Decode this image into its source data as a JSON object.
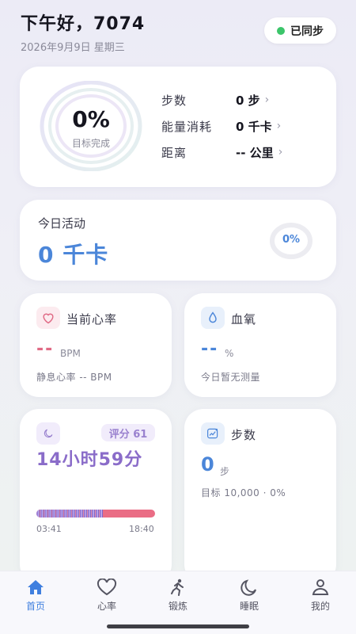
{
  "header": {
    "greeting": "下午好，7074",
    "date": "2026年9月9日 星期三",
    "sync_label": "已同步"
  },
  "goal_card": {
    "percent": "0%",
    "label": "目标完成",
    "metrics": [
      {
        "label": "步数",
        "value": "0 步"
      },
      {
        "label": "能量消耗",
        "value": "0 千卡"
      },
      {
        "label": "距离",
        "value": "-- 公里"
      }
    ]
  },
  "activity": {
    "title": "今日活动",
    "value": "0 千卡",
    "percent": "0%"
  },
  "heart_rate": {
    "title": "当前心率",
    "value": "--",
    "unit": "BPM",
    "resting": "静息心率 -- BPM"
  },
  "blood_oxygen": {
    "title": "血氧",
    "value": "--",
    "unit": "%",
    "note": "今日暂无测量"
  },
  "sleep": {
    "score": "评分 61",
    "duration": "14小时59分",
    "start": "03:41",
    "end": "18:40"
  },
  "steps_card": {
    "title": "步数",
    "value": "0",
    "unit": "步",
    "goal": "目标 10,000 · 0%"
  },
  "nav": [
    {
      "label": "首页",
      "icon": "home-icon",
      "active": true
    },
    {
      "label": "心率",
      "icon": "heart-icon",
      "active": false
    },
    {
      "label": "锻炼",
      "icon": "run-icon",
      "active": false
    },
    {
      "label": "睡眠",
      "icon": "moon-icon",
      "active": false
    },
    {
      "label": "我的",
      "icon": "person-icon",
      "active": false
    }
  ],
  "colors": {
    "accent_blue": "#4b86d9",
    "heart_pink": "#e06a85",
    "sleep_purple": "#8a6cc9",
    "sync_green": "#3cc56a"
  }
}
